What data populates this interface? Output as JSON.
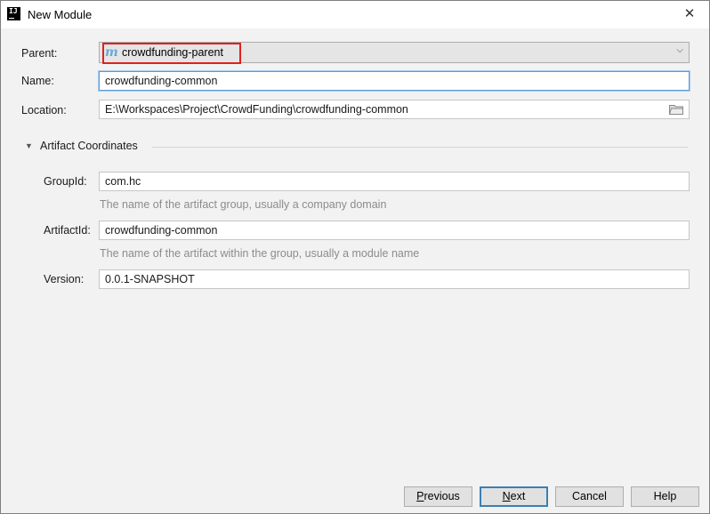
{
  "window": {
    "title": "New Module",
    "app_icon": "intellij-idea-icon",
    "close_icon": "✕"
  },
  "form": {
    "parent_label": "Parent:",
    "parent_value": "crowdfunding-parent",
    "parent_icon_letter": "m",
    "name_label": "Name:",
    "name_value": "crowdfunding-common",
    "location_label": "Location:",
    "location_value": "E:\\Workspaces\\Project\\CrowdFunding\\crowdfunding-common"
  },
  "artifact": {
    "section_title": "Artifact Coordinates",
    "group_label": "GroupId:",
    "group_value": "com.hc",
    "group_hint": "The name of the artifact group, usually a company domain",
    "artifact_label": "ArtifactId:",
    "artifact_value": "crowdfunding-common",
    "artifact_hint": "The name of the artifact within the group, usually a module name",
    "version_label": "Version:",
    "version_value": "0.0.1-SNAPSHOT"
  },
  "buttons": {
    "previous_first": "P",
    "previous_rest": "revious",
    "next_first": "N",
    "next_rest": "ext",
    "cancel": "Cancel",
    "help": "Help"
  },
  "colors": {
    "highlight_box": "#e02020",
    "focus_border": "#5a9bd5",
    "hint_text": "#8c8c8c"
  }
}
